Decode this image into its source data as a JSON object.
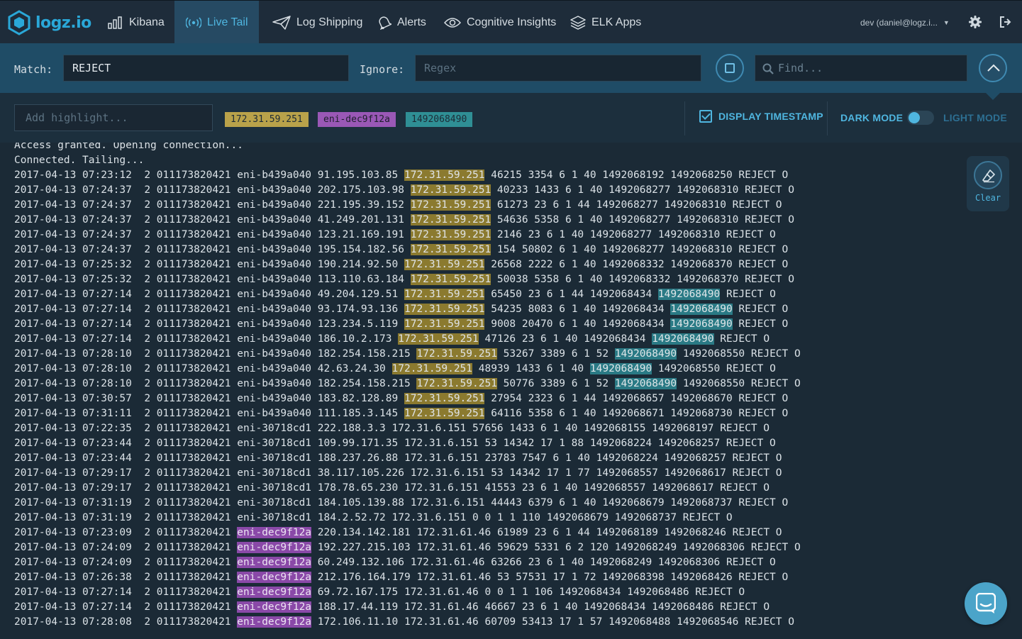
{
  "app": {
    "name": "logz.io"
  },
  "nav": {
    "items": [
      {
        "label": "Kibana",
        "icon": "bar-chart-icon"
      },
      {
        "label": "Live Tail",
        "icon": "broadcast-icon",
        "active": true
      },
      {
        "label": "Log Shipping",
        "icon": "paper-plane-icon"
      },
      {
        "label": "Alerts",
        "icon": "bell-icon"
      },
      {
        "label": "Cognitive Insights",
        "icon": "eye-icon"
      },
      {
        "label": "ELK Apps",
        "icon": "layers-icon"
      }
    ],
    "user": "dev (daniel@logz.i...",
    "settings_icon": "gear-icon",
    "logout_icon": "logout-icon"
  },
  "filters": {
    "match_label": "Match:",
    "match_value": "REJECT",
    "ignore_label": "Ignore:",
    "ignore_placeholder": "Regex",
    "find_placeholder": "Find...",
    "highlight_placeholder": "Add highlight...",
    "highlights": [
      {
        "text": "172.31.59.251",
        "color": "#b9a24a"
      },
      {
        "text": "eni-dec9f12a",
        "color": "#9a58b6"
      },
      {
        "text": "1492068490",
        "color": "#2f8f95"
      }
    ]
  },
  "display": {
    "timestamp_label": "DISPLAY TIMESTAMP",
    "timestamp_checked": true,
    "dark_mode_label": "DARK MODE",
    "light_mode_label": "LIGHT MODE",
    "mode": "dark"
  },
  "clear_label": "Clear",
  "colors": {
    "accent": "#4fb6e0",
    "nav_active_bg": "#264a63",
    "match_bar_bg": "#1f4c66"
  },
  "log": {
    "header_lines": [
      "Access granted. Opening connection...",
      "Connected. Tailing..."
    ],
    "lines": [
      "2017-04-13 07:23:12  2 011173820421 eni-b439a040 91.195.103.85 172.31.59.251 46215 3354 6 1 40 1492068192 1492068250 REJECT O",
      "2017-04-13 07:24:37  2 011173820421 eni-b439a040 202.175.103.98 172.31.59.251 40233 1433 6 1 40 1492068277 1492068310 REJECT O",
      "2017-04-13 07:24:37  2 011173820421 eni-b439a040 221.195.39.152 172.31.59.251 61273 23 6 1 44 1492068277 1492068310 REJECT O",
      "2017-04-13 07:24:37  2 011173820421 eni-b439a040 41.249.201.131 172.31.59.251 54636 5358 6 1 40 1492068277 1492068310 REJECT O",
      "2017-04-13 07:24:37  2 011173820421 eni-b439a040 123.21.169.191 172.31.59.251 2146 23 6 1 40 1492068277 1492068310 REJECT O",
      "2017-04-13 07:24:37  2 011173820421 eni-b439a040 195.154.182.56 172.31.59.251 154 50802 6 1 40 1492068277 1492068310 REJECT O",
      "2017-04-13 07:25:32  2 011173820421 eni-b439a040 190.214.92.50 172.31.59.251 26568 2222 6 1 40 1492068332 1492068370 REJECT O",
      "2017-04-13 07:25:32  2 011173820421 eni-b439a040 113.110.63.184 172.31.59.251 50038 5358 6 1 40 1492068332 1492068370 REJECT O",
      "2017-04-13 07:27:14  2 011173820421 eni-b439a040 49.204.129.51 172.31.59.251 65450 23 6 1 44 1492068434 1492068490 REJECT O",
      "2017-04-13 07:27:14  2 011173820421 eni-b439a040 93.174.93.136 172.31.59.251 54235 8083 6 1 40 1492068434 1492068490 REJECT O",
      "2017-04-13 07:27:14  2 011173820421 eni-b439a040 123.234.5.119 172.31.59.251 9008 20470 6 1 40 1492068434 1492068490 REJECT O",
      "2017-04-13 07:27:14  2 011173820421 eni-b439a040 186.10.2.173 172.31.59.251 47126 23 6 1 40 1492068434 1492068490 REJECT O",
      "2017-04-13 07:28:10  2 011173820421 eni-b439a040 182.254.158.215 172.31.59.251 53267 3389 6 1 52 1492068490 1492068550 REJECT O",
      "2017-04-13 07:28:10  2 011173820421 eni-b439a040 42.63.24.30 172.31.59.251 48939 1433 6 1 40 1492068490 1492068550 REJECT O",
      "2017-04-13 07:28:10  2 011173820421 eni-b439a040 182.254.158.215 172.31.59.251 50776 3389 6 1 52 1492068490 1492068550 REJECT O",
      "2017-04-13 07:30:57  2 011173820421 eni-b439a040 183.82.128.89 172.31.59.251 27954 2323 6 1 44 1492068657 1492068670 REJECT O",
      "2017-04-13 07:31:11  2 011173820421 eni-b439a040 111.185.3.145 172.31.59.251 64116 5358 6 1 40 1492068671 1492068730 REJECT O",
      "2017-04-13 07:22:35  2 011173820421 eni-30718cd1 222.188.3.3 172.31.6.151 57656 1433 6 1 40 1492068155 1492068197 REJECT O",
      "2017-04-13 07:23:44  2 011173820421 eni-30718cd1 109.99.171.35 172.31.6.151 53 14342 17 1 88 1492068224 1492068257 REJECT O",
      "2017-04-13 07:23:44  2 011173820421 eni-30718cd1 188.237.26.88 172.31.6.151 23783 7547 6 1 40 1492068224 1492068257 REJECT O",
      "2017-04-13 07:29:17  2 011173820421 eni-30718cd1 38.117.105.226 172.31.6.151 53 14342 17 1 77 1492068557 1492068617 REJECT O",
      "2017-04-13 07:29:17  2 011173820421 eni-30718cd1 178.78.65.230 172.31.6.151 41553 23 6 1 40 1492068557 1492068617 REJECT O",
      "2017-04-13 07:31:19  2 011173820421 eni-30718cd1 184.105.139.88 172.31.6.151 44443 6379 6 1 40 1492068679 1492068737 REJECT O",
      "2017-04-13 07:31:19  2 011173820421 eni-30718cd1 184.2.52.72 172.31.6.151 0 0 1 1 110 1492068679 1492068737 REJECT O",
      "2017-04-13 07:23:09  2 011173820421 eni-dec9f12a 220.134.142.181 172.31.61.46 61989 23 6 1 44 1492068189 1492068246 REJECT O",
      "2017-04-13 07:24:09  2 011173820421 eni-dec9f12a 192.227.215.103 172.31.61.46 59629 5331 6 2 120 1492068249 1492068306 REJECT O",
      "2017-04-13 07:24:09  2 011173820421 eni-dec9f12a 60.249.132.106 172.31.61.46 63266 23 6 1 40 1492068249 1492068306 REJECT O",
      "2017-04-13 07:26:38  2 011173820421 eni-dec9f12a 212.176.164.179 172.31.61.46 53 57531 17 1 72 1492068398 1492068426 REJECT O",
      "2017-04-13 07:27:14  2 011173820421 eni-dec9f12a 69.72.167.175 172.31.61.46 0 0 1 1 106 1492068434 1492068486 REJECT O",
      "2017-04-13 07:27:14  2 011173820421 eni-dec9f12a 188.17.44.119 172.31.61.46 46667 23 6 1 40 1492068434 1492068486 REJECT O",
      "2017-04-13 07:28:08  2 011173820421 eni-dec9f12a 172.106.11.10 172.31.61.46 60709 53413 17 1 57 1492068488 1492068546 REJECT O"
    ]
  }
}
